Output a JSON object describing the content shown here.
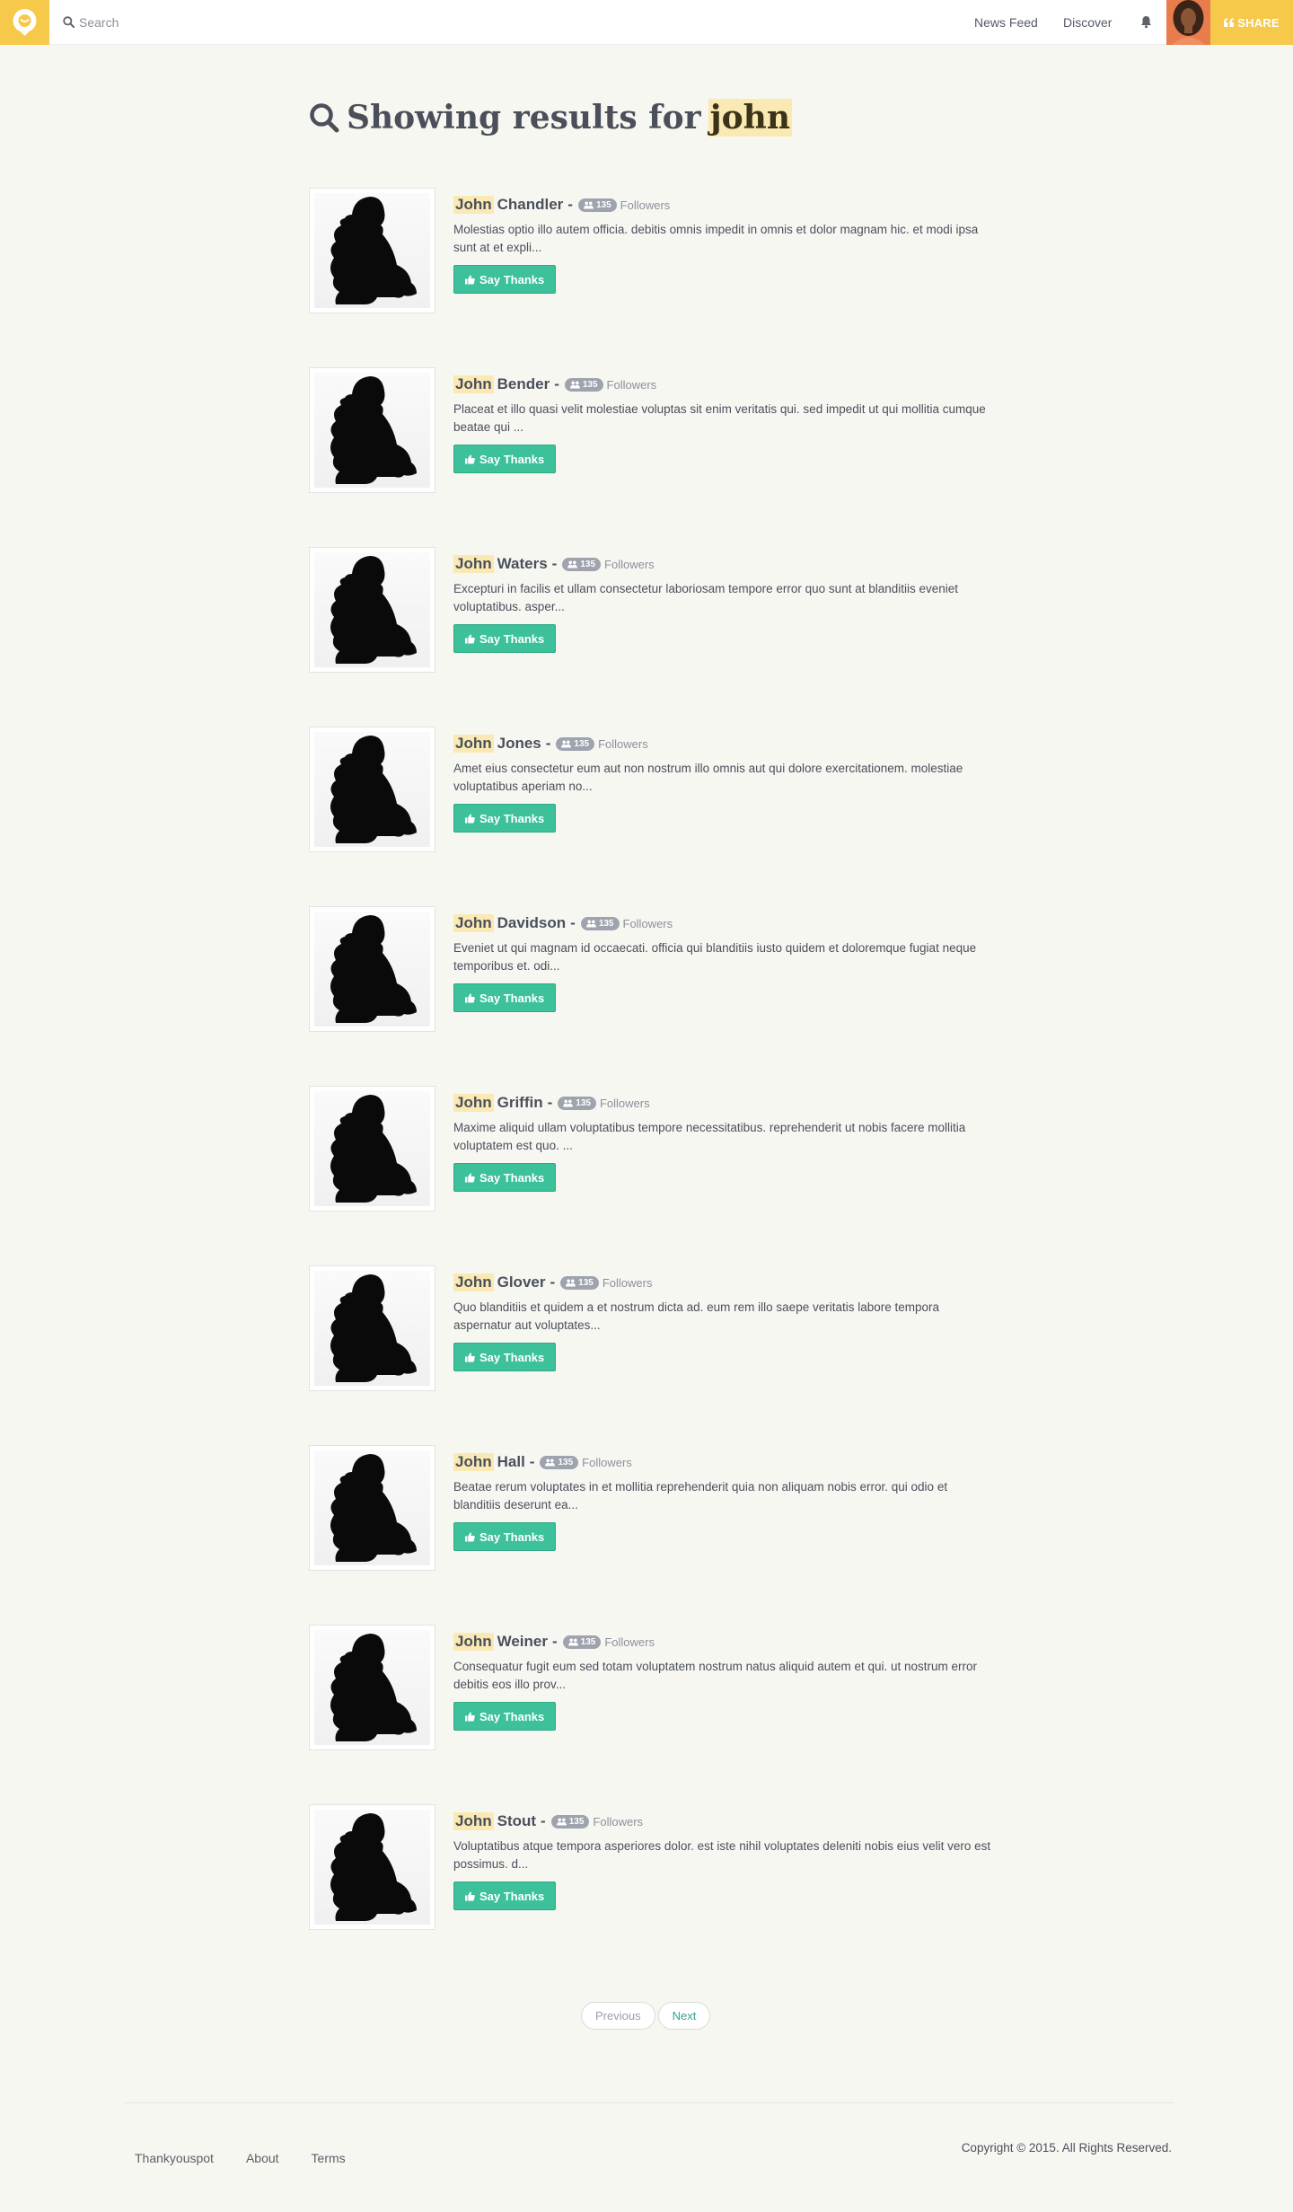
{
  "header": {
    "search_placeholder": "Search",
    "nav": [
      "News Feed",
      "Discover"
    ],
    "share_label": "SHARE",
    "brand_color": "#f6c94a",
    "icons": [
      "logo-icon",
      "search-icon",
      "bell-icon",
      "quote-icon"
    ]
  },
  "heading": {
    "prefix": "Showing results for",
    "query": "john"
  },
  "results": [
    {
      "first": "John",
      "last": "Chandler",
      "followers": "135",
      "followers_label": "Followers",
      "desc": "Molestias optio illo autem officia. debitis omnis impedit in omnis et dolor magnam hic. et modi ipsa sunt at et expli...",
      "button": "Say Thanks"
    },
    {
      "first": "John",
      "last": "Bender",
      "followers": "135",
      "followers_label": "Followers",
      "desc": "Placeat et illo quasi velit molestiae voluptas sit enim veritatis qui. sed impedit ut qui mollitia cumque beatae qui ...",
      "button": "Say Thanks"
    },
    {
      "first": "John",
      "last": "Waters",
      "followers": "135",
      "followers_label": "Followers",
      "desc": "Excepturi in facilis et ullam consectetur laboriosam tempore error quo sunt at blanditiis eveniet voluptatibus. asper...",
      "button": "Say Thanks"
    },
    {
      "first": "John",
      "last": "Jones",
      "followers": "135",
      "followers_label": "Followers",
      "desc": "Amet eius consectetur eum aut non nostrum illo omnis aut qui dolore exercitationem. molestiae voluptatibus aperiam no...",
      "button": "Say Thanks"
    },
    {
      "first": "John",
      "last": "Davidson",
      "followers": "135",
      "followers_label": "Followers",
      "desc": "Eveniet ut qui magnam id occaecati. officia qui blanditiis iusto quidem et doloremque fugiat neque temporibus et. odi...",
      "button": "Say Thanks"
    },
    {
      "first": "John",
      "last": "Griffin",
      "followers": "135",
      "followers_label": "Followers",
      "desc": "Maxime aliquid ullam voluptatibus tempore necessitatibus. reprehenderit ut nobis facere mollitia voluptatem est quo. ...",
      "button": "Say Thanks"
    },
    {
      "first": "John",
      "last": "Glover",
      "followers": "135",
      "followers_label": "Followers",
      "desc": "Quo blanditiis et quidem a et nostrum dicta ad. eum rem illo saepe veritatis labore tempora aspernatur aut voluptates...",
      "button": "Say Thanks"
    },
    {
      "first": "John",
      "last": "Hall",
      "followers": "135",
      "followers_label": "Followers",
      "desc": "Beatae rerum voluptates in et mollitia reprehenderit quia non aliquam nobis error. qui odio et blanditiis deserunt ea...",
      "button": "Say Thanks"
    },
    {
      "first": "John",
      "last": "Weiner",
      "followers": "135",
      "followers_label": "Followers",
      "desc": "Consequatur fugit eum sed totam voluptatem nostrum natus aliquid autem et qui. ut nostrum error debitis eos illo prov...",
      "button": "Say Thanks"
    },
    {
      "first": "John",
      "last": "Stout",
      "followers": "135",
      "followers_label": "Followers",
      "desc": "Voluptatibus atque tempora asperiores dolor. est iste nihil voluptates deleniti nobis eius velit vero est possimus. d...",
      "button": "Say Thanks"
    }
  ],
  "pagination": {
    "previous": "Previous",
    "next": "Next"
  },
  "footer": {
    "links": [
      "Thankyouspot",
      "About",
      "Terms"
    ],
    "copyright": "Copyright © 2015. All Rights Reserved."
  },
  "colors": {
    "accent_green": "#3cc19a",
    "highlight": "#fbe9b4",
    "background": "#f7f7f2"
  }
}
